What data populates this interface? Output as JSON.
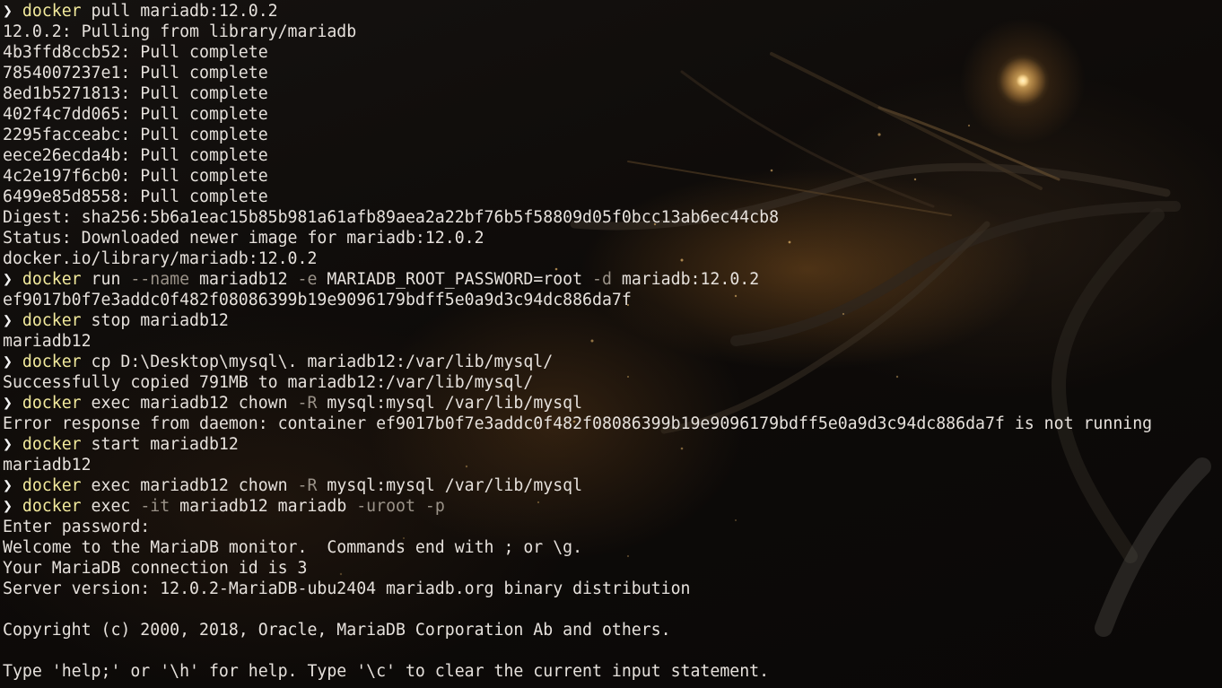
{
  "terminal": {
    "lines": [
      {
        "type": "command",
        "prompt": "❯",
        "command": "docker",
        "parts": [
          {
            "t": "arg",
            "v": " pull mariadb:12.0.2"
          }
        ]
      },
      {
        "type": "output",
        "text": "12.0.2: Pulling from library/mariadb"
      },
      {
        "type": "output",
        "text": "4b3ffd8ccb52: Pull complete"
      },
      {
        "type": "output",
        "text": "7854007237e1: Pull complete"
      },
      {
        "type": "output",
        "text": "8ed1b5271813: Pull complete"
      },
      {
        "type": "output",
        "text": "402f4c7dd065: Pull complete"
      },
      {
        "type": "output",
        "text": "2295facceabc: Pull complete"
      },
      {
        "type": "output",
        "text": "eece26ecda4b: Pull complete"
      },
      {
        "type": "output",
        "text": "4c2e197f6cb0: Pull complete"
      },
      {
        "type": "output",
        "text": "6499e85d8558: Pull complete"
      },
      {
        "type": "output",
        "text": "Digest: sha256:5b6a1eac15b85b981a61afb89aea2a22bf76b5f58809d05f0bcc13ab6ec44cb8"
      },
      {
        "type": "output",
        "text": "Status: Downloaded newer image for mariadb:12.0.2"
      },
      {
        "type": "output",
        "text": "docker.io/library/mariadb:12.0.2"
      },
      {
        "type": "command",
        "prompt": "❯",
        "command": "docker",
        "parts": [
          {
            "t": "arg",
            "v": " run "
          },
          {
            "t": "flag",
            "v": "--name"
          },
          {
            "t": "arg",
            "v": " mariadb12 "
          },
          {
            "t": "flag",
            "v": "-e"
          },
          {
            "t": "arg",
            "v": " MARIADB_ROOT_PASSWORD=root "
          },
          {
            "t": "flag",
            "v": "-d"
          },
          {
            "t": "arg",
            "v": " mariadb:12.0.2"
          }
        ]
      },
      {
        "type": "output",
        "text": "ef9017b0f7e3addc0f482f08086399b19e9096179bdff5e0a9d3c94dc886da7f"
      },
      {
        "type": "command",
        "prompt": "❯",
        "command": "docker",
        "parts": [
          {
            "t": "arg",
            "v": " stop mariadb12"
          }
        ]
      },
      {
        "type": "output",
        "text": "mariadb12"
      },
      {
        "type": "command",
        "prompt": "❯",
        "command": "docker",
        "parts": [
          {
            "t": "arg",
            "v": " cp D:\\Desktop\\mysql\\. mariadb12:/var/lib/mysql/"
          }
        ]
      },
      {
        "type": "output",
        "text": "Successfully copied 791MB to mariadb12:/var/lib/mysql/"
      },
      {
        "type": "command",
        "prompt": "❯",
        "command": "docker",
        "parts": [
          {
            "t": "arg",
            "v": " exec mariadb12 chown "
          },
          {
            "t": "flag",
            "v": "-R"
          },
          {
            "t": "arg",
            "v": " mysql:mysql /var/lib/mysql"
          }
        ]
      },
      {
        "type": "output",
        "text": "Error response from daemon: container ef9017b0f7e3addc0f482f08086399b19e9096179bdff5e0a9d3c94dc886da7f is not running"
      },
      {
        "type": "command",
        "prompt": "❯",
        "command": "docker",
        "parts": [
          {
            "t": "arg",
            "v": " start mariadb12"
          }
        ]
      },
      {
        "type": "output",
        "text": "mariadb12"
      },
      {
        "type": "command",
        "prompt": "❯",
        "command": "docker",
        "parts": [
          {
            "t": "arg",
            "v": " exec mariadb12 chown "
          },
          {
            "t": "flag",
            "v": "-R"
          },
          {
            "t": "arg",
            "v": " mysql:mysql /var/lib/mysql"
          }
        ]
      },
      {
        "type": "command",
        "prompt": "❯",
        "command": "docker",
        "parts": [
          {
            "t": "arg",
            "v": " exec "
          },
          {
            "t": "flag",
            "v": "-it"
          },
          {
            "t": "arg",
            "v": " mariadb12 mariadb "
          },
          {
            "t": "flag",
            "v": "-uroot"
          },
          {
            "t": "arg",
            "v": " "
          },
          {
            "t": "flag",
            "v": "-p"
          }
        ]
      },
      {
        "type": "output",
        "text": "Enter password:"
      },
      {
        "type": "output",
        "text": "Welcome to the MariaDB monitor.  Commands end with ; or \\g."
      },
      {
        "type": "output",
        "text": "Your MariaDB connection id is 3"
      },
      {
        "type": "output",
        "text": "Server version: 12.0.2-MariaDB-ubu2404 mariadb.org binary distribution"
      },
      {
        "type": "output",
        "text": ""
      },
      {
        "type": "output",
        "text": "Copyright (c) 2000, 2018, Oracle, MariaDB Corporation Ab and others."
      },
      {
        "type": "output",
        "text": ""
      },
      {
        "type": "output",
        "text": "Type 'help;' or '\\h' for help. Type '\\c' to clear the current input statement."
      }
    ]
  },
  "colors": {
    "background": "#0b0908",
    "text": "#e6e1dc",
    "command": "#f2ea9c",
    "flag": "#9a9288",
    "prompt": "#f2f2f2",
    "accent_glow": "#ffcf80"
  }
}
